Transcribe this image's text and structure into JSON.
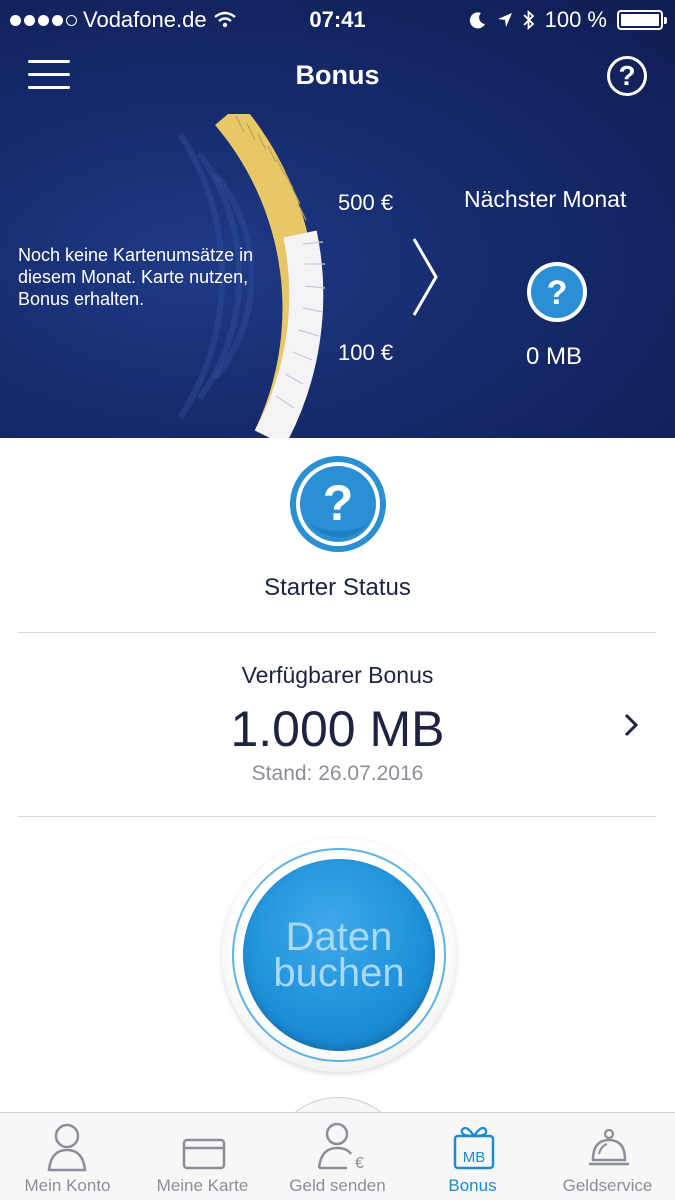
{
  "status_bar": {
    "carrier": "Vodafone.de",
    "time": "07:41",
    "battery": "100 %"
  },
  "nav": {
    "title": "Bonus",
    "help_symbol": "?"
  },
  "hero": {
    "message": "Noch keine Kartenumsätze in diesem Monat. Karte nutzen, Bonus erhalten.",
    "upper_amount": "500 €",
    "lower_amount": "100 €",
    "next_month_title": "Nächster Monat",
    "next_month_value": "0 MB"
  },
  "status": {
    "label": "Starter Status"
  },
  "bonus": {
    "label": "Verfügbarer Bonus",
    "value": "1.000 MB",
    "date": "Stand: 26.07.2016"
  },
  "book_button": {
    "line1": "Daten",
    "line2": "buchen"
  },
  "tabs": [
    {
      "label": "Mein Konto",
      "icon": "person-icon",
      "active": false
    },
    {
      "label": "Meine Karte",
      "icon": "card-icon",
      "active": false
    },
    {
      "label": "Geld senden",
      "icon": "send-money-icon",
      "active": false
    },
    {
      "label": "Bonus",
      "icon": "mb-gift-icon",
      "active": true
    },
    {
      "label": "Geldservice",
      "icon": "service-bell-icon",
      "active": false
    }
  ],
  "colors": {
    "hero_bg": "#162a6b",
    "accent_blue": "#1a8ccf",
    "gold": "#e8c766",
    "text_dark": "#1d2340"
  }
}
